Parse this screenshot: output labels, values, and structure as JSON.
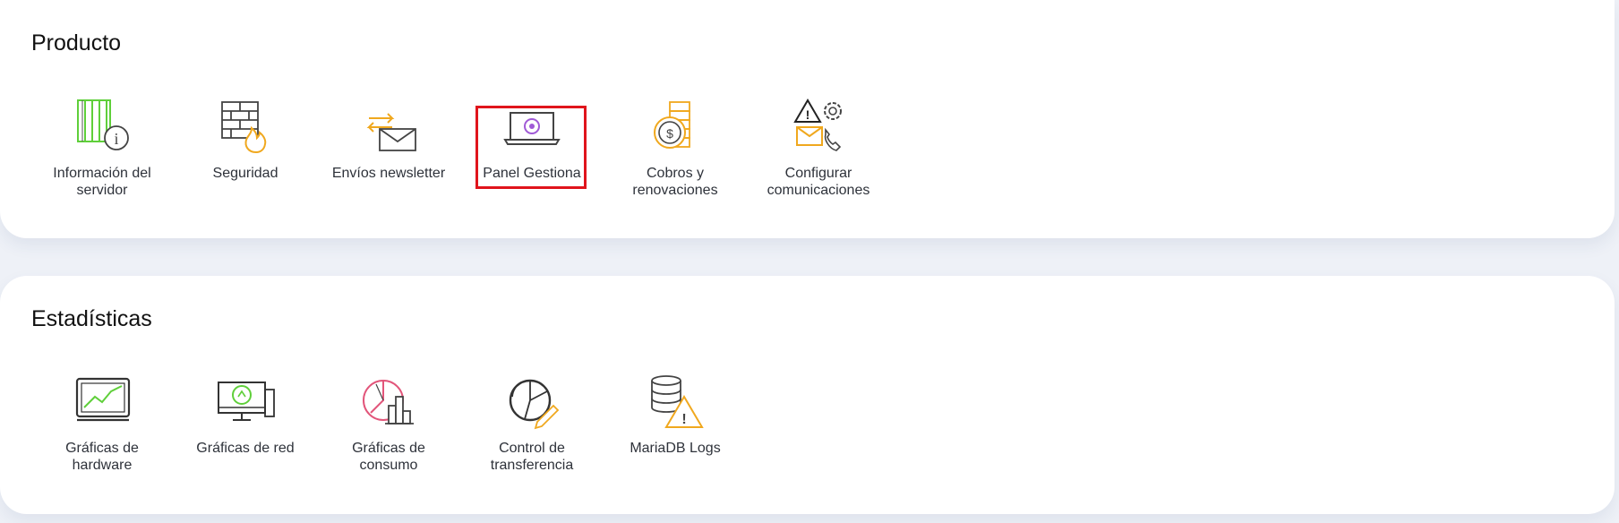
{
  "sections": [
    {
      "title": "Producto",
      "items": [
        {
          "label": "Información del servidor",
          "icon": "server-info-icon"
        },
        {
          "label": "Seguridad",
          "icon": "firewall-icon"
        },
        {
          "label": "Envíos newsletter",
          "icon": "newsletter-icon"
        },
        {
          "label": "Panel Gestiona",
          "icon": "laptop-panel-icon"
        },
        {
          "label": "Cobros y renovaciones",
          "icon": "billing-icon"
        },
        {
          "label": "Configurar comunicaciones",
          "icon": "communications-settings-icon"
        }
      ]
    },
    {
      "title": "Estadísticas",
      "items": [
        {
          "label": "Gráficas de hardware",
          "icon": "hardware-chart-icon"
        },
        {
          "label": "Gráficas de red",
          "icon": "network-chart-icon"
        },
        {
          "label": "Gráficas de consumo",
          "icon": "consumption-chart-icon"
        },
        {
          "label": "Control de transferencia",
          "icon": "transfer-control-icon"
        },
        {
          "label": "MariaDB Logs",
          "icon": "mariadb-logs-icon"
        }
      ]
    }
  ],
  "colors": {
    "background": "#eef1f7",
    "card": "#ffffff",
    "highlight": "#e0141c",
    "green": "#5fcf3a",
    "orange": "#f0a81e",
    "purple": "#a05ad6",
    "pink": "#e2557a"
  }
}
